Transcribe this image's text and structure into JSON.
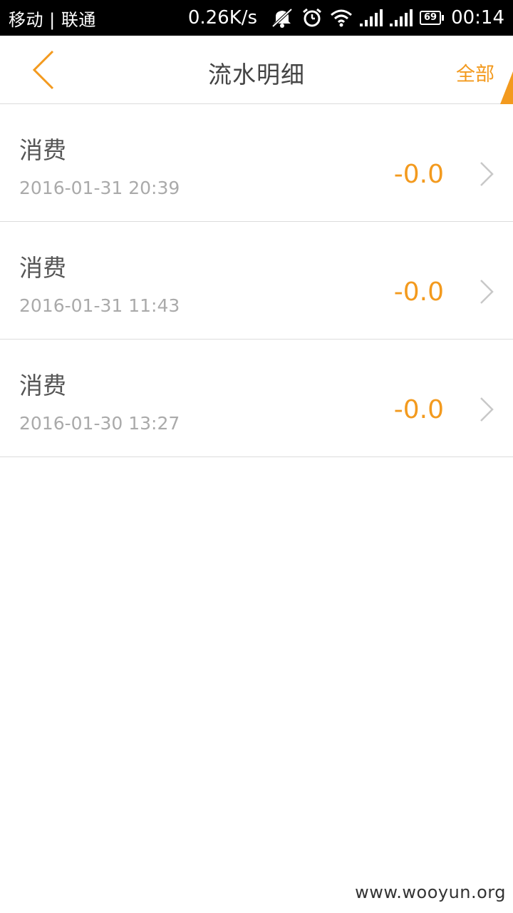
{
  "status_bar": {
    "carrier": "移动 | 联通",
    "net_speed": "0.26K/s",
    "battery_level": "69",
    "time": "00:14",
    "icons": [
      "mute-icon",
      "alarm-icon",
      "wifi-icon",
      "signal-icon",
      "signal-icon",
      "battery-icon"
    ]
  },
  "header": {
    "title": "流水明细",
    "filter_label": "全部",
    "back_icon": "chevron-left-icon",
    "accent_color": "#f39a1e"
  },
  "transactions": [
    {
      "type": "消费",
      "time": "2016-01-31 20:39",
      "amount": "-0.0"
    },
    {
      "type": "消费",
      "time": "2016-01-31 11:43",
      "amount": "-0.0"
    },
    {
      "type": "消费",
      "time": "2016-01-30 13:27",
      "amount": "-0.0"
    }
  ],
  "watermark": "www.wooyun.org"
}
